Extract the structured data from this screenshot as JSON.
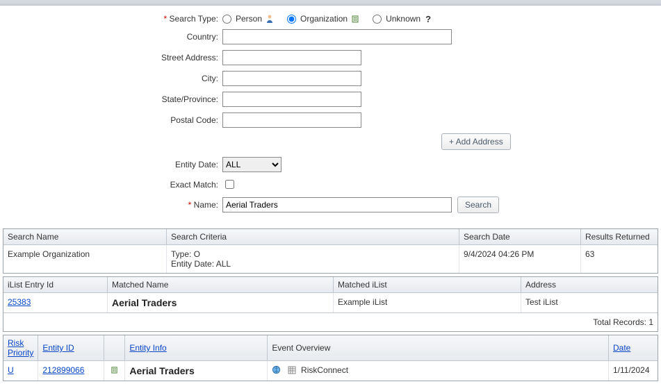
{
  "form": {
    "search_type_label": "Search Type:",
    "opts": {
      "person": "Person",
      "organization": "Organization",
      "unknown": "Unknown"
    },
    "country_label": "Country:",
    "street_label": "Street Address:",
    "city_label": "City:",
    "state_label": "State/Province:",
    "postal_label": "Postal Code:",
    "add_address_btn": "+ Add Address",
    "entity_date_label": "Entity Date:",
    "entity_date_value": "ALL",
    "exact_match_label": "Exact Match:",
    "name_label": "Name:",
    "name_value": "Aerial Traders",
    "search_btn": "Search"
  },
  "history": {
    "headers": {
      "name": "Search Name",
      "criteria": "Search Criteria",
      "date": "Search Date",
      "results": "Results Returned"
    },
    "row": {
      "name": "Example Organization",
      "criteria_line1": "Type: O",
      "criteria_line2": "Entity Date: ALL",
      "date": "9/4/2024 04:26 PM",
      "results": "63"
    }
  },
  "ilist": {
    "headers": {
      "entry_id": "iList Entry Id",
      "matched_name": "Matched Name",
      "matched_ilist": "Matched iList",
      "address": "Address"
    },
    "row": {
      "entry_id": "25383",
      "matched_name": "Aerial Traders",
      "matched_ilist": "Example iList",
      "address": "Test iList"
    },
    "footer": "Total Records: 1"
  },
  "detail": {
    "headers": {
      "risk": "Risk Priority",
      "entity_id": "Entity ID",
      "entity_info": "Entity Info",
      "event": "Event Overview",
      "date": "Date"
    },
    "row": {
      "risk": "U",
      "entity_id": "212899066",
      "entity_info": "Aerial Traders",
      "event": "RiskConnect",
      "date": "1/11/2024"
    }
  }
}
